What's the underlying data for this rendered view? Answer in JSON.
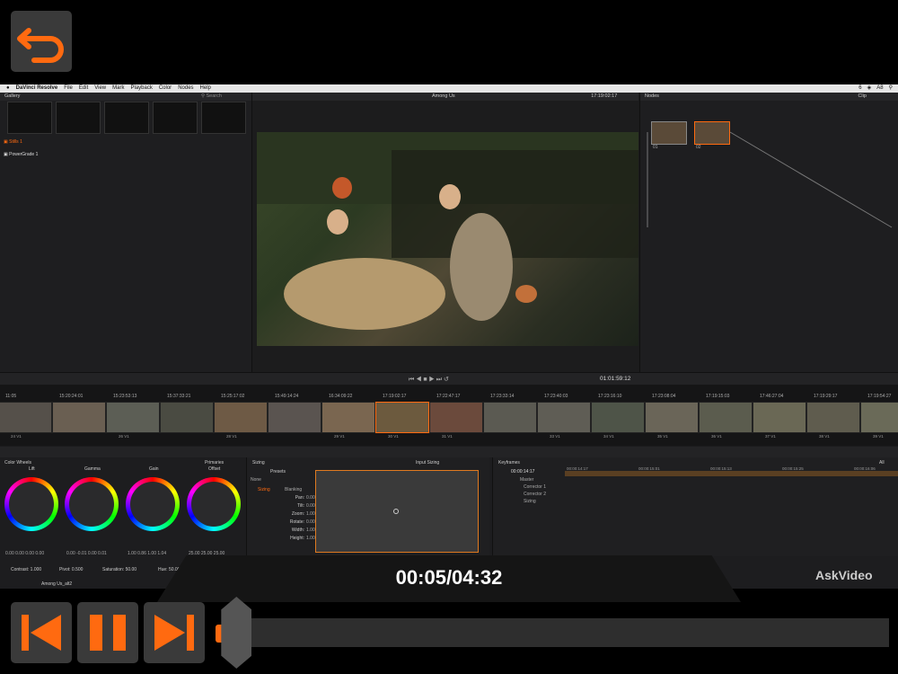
{
  "menubar": {
    "apple": "",
    "items": [
      "DaVinci Resolve",
      "File",
      "Edit",
      "View",
      "Mark",
      "Playback",
      "Color",
      "Nodes",
      "Help"
    ],
    "status": [
      "6",
      "A8"
    ]
  },
  "gallery": {
    "title": "Gallery",
    "search": "Search",
    "albums": [
      "Stills 1",
      "PowerGrade 1"
    ]
  },
  "viewer": {
    "project": "Among Us",
    "timecode": "17:19:02:17",
    "playhead_tc": "01:01:59:12"
  },
  "nodes": {
    "title": "Nodes",
    "clip": "Clip",
    "node_labels": [
      "01",
      "02"
    ]
  },
  "timeline": {
    "timecodes": [
      "11:05",
      "15:20:24:01",
      "15:23:53:13",
      "15:37:33:21",
      "15:25:17:02",
      "15:49:14:24",
      "16:34:09:22",
      "17:19:02:17",
      "17:22:47:17",
      "17:23:33:14",
      "17:23:40:03",
      "17:23:16:10",
      "17:23:08:04",
      "17:19:15:03",
      "17:46:27:04",
      "17:19:29:17",
      "17:19:54:27"
    ],
    "labels": [
      "24  V1",
      "",
      "26  V1",
      "",
      "28  V1",
      "",
      "29  V1",
      "30  V1",
      "31  V1",
      "",
      "33  V1",
      "34  V1",
      "35  V1",
      "36  V1",
      "37  V1",
      "38  V1",
      "39  V1"
    ]
  },
  "colorwheels": {
    "title": "Color Wheels",
    "mode": "Primaries",
    "wheels": [
      {
        "name": "Lift",
        "values": "0.00  0.00  0.00  0.00"
      },
      {
        "name": "Gamma",
        "values": "0.00  -0.01  0.00  0.01"
      },
      {
        "name": "Gain",
        "values": "1.00  0.86  1.00  1.04"
      },
      {
        "name": "Offset",
        "values": "25.00  25.00  25.00"
      }
    ],
    "contrast": "Contrast: 1.000",
    "pivot": "Pivot: 0.500",
    "saturation": "Saturation: 50.00",
    "hue": "Hue: 50.000"
  },
  "sizing": {
    "title": "Sizing",
    "presets": "Presets",
    "input_sizing": "Input Sizing",
    "preset_value": "None",
    "tabs": [
      "Sizing",
      "Blanking"
    ],
    "params": [
      {
        "label": "Pan:",
        "value": "0.000"
      },
      {
        "label": "Tilt:",
        "value": "0.000"
      },
      {
        "label": "Zoom:",
        "value": "1.000"
      },
      {
        "label": "Rotate:",
        "value": "0.000"
      },
      {
        "label": "Width:",
        "value": "1.000"
      },
      {
        "label": "Height:",
        "value": "1.000"
      }
    ]
  },
  "keyframes": {
    "title": "Keyframes",
    "all": "All",
    "timecode": "00:00:14:17",
    "tracks": [
      "Master",
      "Corrector 1",
      "Corrector 2",
      "Sizing"
    ],
    "ruler": [
      "00:00:14:17",
      "00:00:15:01",
      "00:00:15:13",
      "00:00:15:25",
      "00:00:16:06"
    ]
  },
  "footer": {
    "clip_name": "Among Us_alt2"
  },
  "player": {
    "time": "00:05/04:32",
    "logo": "AskVideo",
    "progress_fraction": 0.018
  },
  "colors": {
    "accent": "#ff6a10",
    "button_bg": "#3a3a3a"
  }
}
